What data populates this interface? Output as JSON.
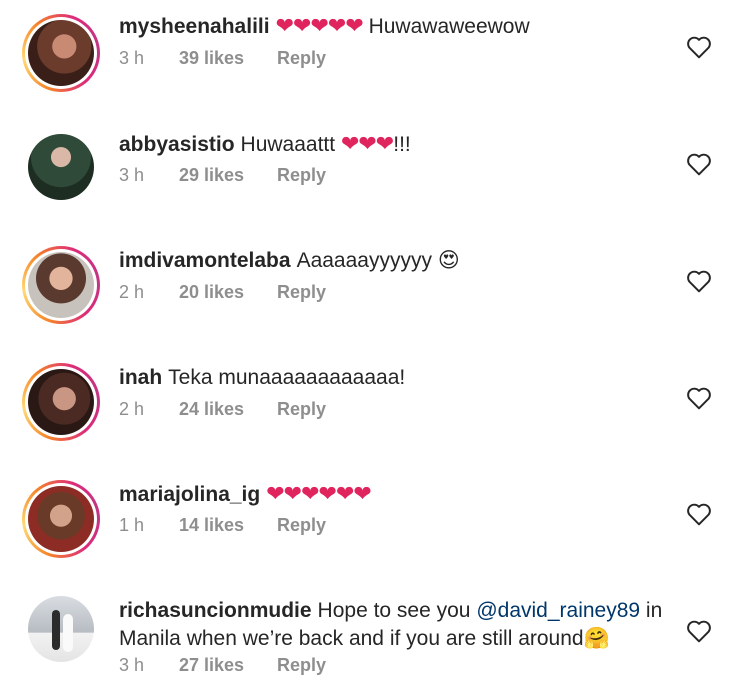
{
  "comments": [
    {
      "username": "mysheenahalili",
      "text_before": "",
      "hearts": "❤❤❤❤❤",
      "text_after": " Huwawaweewow",
      "time": "3 h",
      "likes": "39 likes",
      "reply": "Reply"
    },
    {
      "username": "abbyasistio",
      "text_before": "Huwaaattt ",
      "hearts": "❤❤❤",
      "text_after": "!!!",
      "time": "3 h",
      "likes": "29 likes",
      "reply": "Reply"
    },
    {
      "username": "imdivamontelaba",
      "text_before": "Aaaaaayyyyyy ",
      "emoji": "😍",
      "time": "2 h",
      "likes": "20 likes",
      "reply": "Reply"
    },
    {
      "username": "inah",
      "text_before": "Teka munaaaaaaaaaaaa!",
      "time": "2 h",
      "likes": "24 likes",
      "reply": "Reply"
    },
    {
      "username": "mariajolina_ig",
      "hearts": "❤❤❤❤❤❤",
      "time": "1 h",
      "likes": "14 likes",
      "reply": "Reply"
    },
    {
      "username": "richasuncionmudie",
      "text_before": "Hope to see you ",
      "mention": "@david_rainey89",
      "text_after": " in Manila when we’re back and if you are still around",
      "emoji": "🤗",
      "time": "3 h",
      "likes": "27 likes",
      "reply": "Reply"
    }
  ],
  "icons": {
    "like": "heart-outline-icon"
  },
  "colors": {
    "ring_gradient": [
      "#f58529",
      "#feda77",
      "#dd2a7b",
      "#c13584"
    ],
    "mention": "#00376b",
    "meta": "#8e8e8e",
    "heart_emoji": "#e0245e"
  }
}
